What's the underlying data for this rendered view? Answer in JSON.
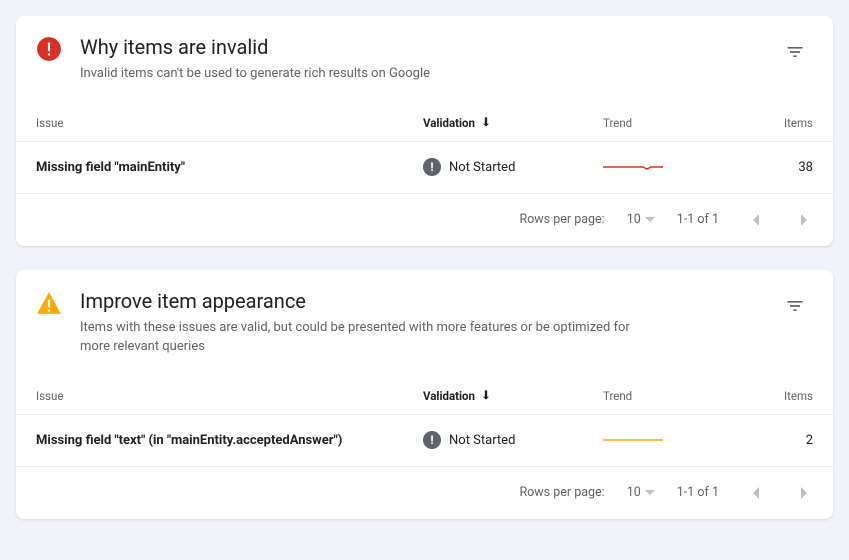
{
  "cards": {
    "invalid": {
      "title": "Why items are invalid",
      "subtitle": "Invalid items can't be used to generate rich results on Google",
      "columns": {
        "issue": "Issue",
        "validation": "Validation",
        "trend": "Trend",
        "items": "Items"
      },
      "rows": [
        {
          "issue": "Missing field \"mainEntity\"",
          "validation": "Not Started",
          "items": "38"
        }
      ],
      "pagination": {
        "rpp_label": "Rows per page:",
        "rpp_value": "10",
        "range": "1-1 of 1"
      }
    },
    "improve": {
      "title": "Improve item appearance",
      "subtitle": "Items with these issues are valid, but could be presented with more features or be optimized for more relevant queries",
      "columns": {
        "issue": "Issue",
        "validation": "Validation",
        "trend": "Trend",
        "items": "Items"
      },
      "rows": [
        {
          "issue": "Missing field \"text\" (in \"mainEntity.acceptedAnswer\")",
          "validation": "Not Started",
          "items": "2"
        }
      ],
      "pagination": {
        "rpp_label": "Rows per page:",
        "rpp_value": "10",
        "range": "1-1 of 1"
      }
    }
  }
}
